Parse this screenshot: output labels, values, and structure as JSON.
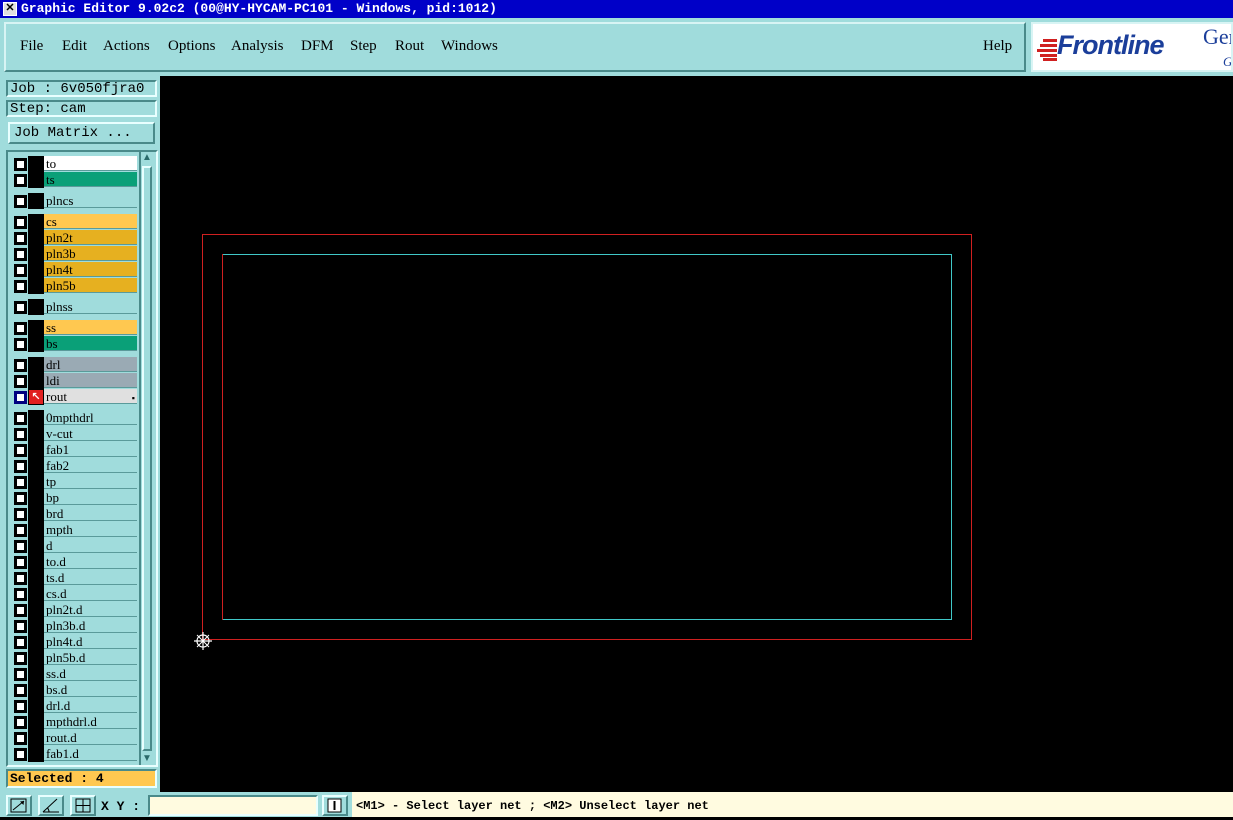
{
  "window": {
    "title": "Graphic Editor 9.02c2 (00@HY-HYCAM-PC101 - Windows, pid:1012)",
    "title_icon": "x-window-icon"
  },
  "menu": {
    "items": [
      "File",
      "Edit",
      "Actions",
      "Options",
      "Analysis",
      "DFM",
      "Step",
      "Rout",
      "Windows"
    ],
    "help": "Help"
  },
  "logo": {
    "brand": "Frontline",
    "gen": "Ger",
    "g": "G"
  },
  "job": {
    "job_label": "Job : 6v050fjra0",
    "step_label": "Step: cam",
    "matrix_button": "Job Matrix ..."
  },
  "layers": [
    {
      "name": "to",
      "color": "#ffffff"
    },
    {
      "name": "ts",
      "color": "#0aa078"
    },
    {
      "name": "plncs",
      "color": "#a0dcdc"
    },
    {
      "name": "cs",
      "color": "#ffc850"
    },
    {
      "name": "pln2t",
      "color": "#e6b020"
    },
    {
      "name": "pln3b",
      "color": "#e6b020"
    },
    {
      "name": "pln4t",
      "color": "#e6b020"
    },
    {
      "name": "pln5b",
      "color": "#e6b020"
    },
    {
      "name": "plnss",
      "color": "#a0dcdc"
    },
    {
      "name": "ss",
      "color": "#ffc850"
    },
    {
      "name": "bs",
      "color": "#0aa078"
    },
    {
      "name": "drl",
      "color": "#9aaab4"
    },
    {
      "name": "ldi",
      "color": "#9aaab4"
    },
    {
      "name": "rout",
      "color": "#e0e0e0",
      "selected": true
    },
    {
      "name": "0mpthdrl",
      "color": "#a0dcdc"
    },
    {
      "name": "v-cut",
      "color": "#a0dcdc"
    },
    {
      "name": "fab1",
      "color": "#a0dcdc"
    },
    {
      "name": "fab2",
      "color": "#a0dcdc"
    },
    {
      "name": "tp",
      "color": "#a0dcdc"
    },
    {
      "name": "bp",
      "color": "#a0dcdc"
    },
    {
      "name": "brd",
      "color": "#a0dcdc"
    },
    {
      "name": "mpth",
      "color": "#a0dcdc"
    },
    {
      "name": "d",
      "color": "#a0dcdc"
    },
    {
      "name": "to.d",
      "color": "#a0dcdc"
    },
    {
      "name": "ts.d",
      "color": "#a0dcdc"
    },
    {
      "name": "cs.d",
      "color": "#a0dcdc"
    },
    {
      "name": "pln2t.d",
      "color": "#a0dcdc"
    },
    {
      "name": "pln3b.d",
      "color": "#a0dcdc"
    },
    {
      "name": "pln4t.d",
      "color": "#a0dcdc"
    },
    {
      "name": "pln5b.d",
      "color": "#a0dcdc"
    },
    {
      "name": "ss.d",
      "color": "#a0dcdc"
    },
    {
      "name": "bs.d",
      "color": "#a0dcdc"
    },
    {
      "name": "drl.d",
      "color": "#a0dcdc"
    },
    {
      "name": "mpthdrl.d",
      "color": "#a0dcdc"
    },
    {
      "name": "rout.d",
      "color": "#a0dcdc"
    },
    {
      "name": "fab1.d",
      "color": "#a0dcdc"
    }
  ],
  "status": {
    "selected": "Selected : 4",
    "xy_label": "X Y :",
    "xy_value": "",
    "message": "<M1> - Select layer net ; <M2> Unselect layer net"
  },
  "colors": {
    "panel": "#a0dcdc",
    "outline_outer": "#d02020",
    "outline_inner": "#40c8c8"
  }
}
